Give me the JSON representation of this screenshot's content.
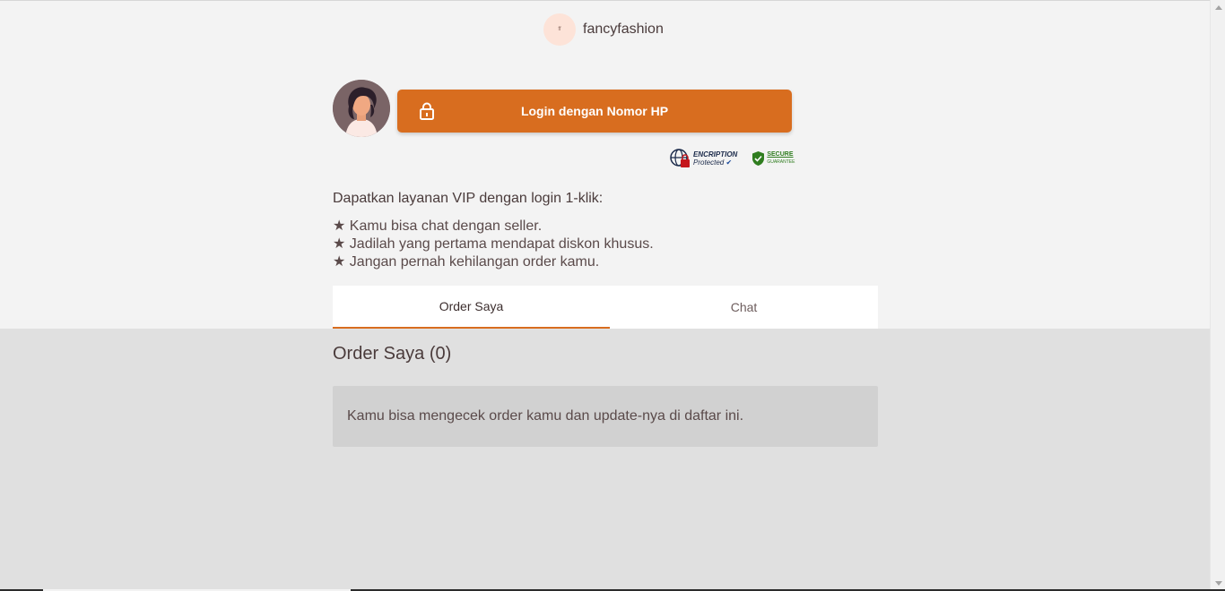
{
  "header": {
    "logo_text": "ff",
    "shop_name": "fancyfashion"
  },
  "login": {
    "button_label": "Login dengan Nomor HP"
  },
  "badges": {
    "encryption_title": "ENCRIPTION",
    "encryption_sub": "Protected",
    "secure_title": "SECURE",
    "secure_sub": "GUARANTEE"
  },
  "vip": {
    "title": "Dapatkan layanan VIP dengan login 1-klik:",
    "benefits": [
      "★ Kamu bisa chat dengan seller.",
      "★ Jadilah yang pertama mendapat diskon khusus.",
      "★ Jangan pernah kehilangan order kamu."
    ]
  },
  "tabs": {
    "orders_label": "Order Saya",
    "chat_label": "Chat",
    "active": "Order Saya"
  },
  "orders": {
    "title": "Order Saya (0)",
    "empty_message": "Kamu bisa mengecek order kamu dan update-nya di daftar ini."
  },
  "colors": {
    "accent": "#d86d1f",
    "background_top": "#f3f3f3",
    "background_bottom": "#e0e0e0"
  }
}
